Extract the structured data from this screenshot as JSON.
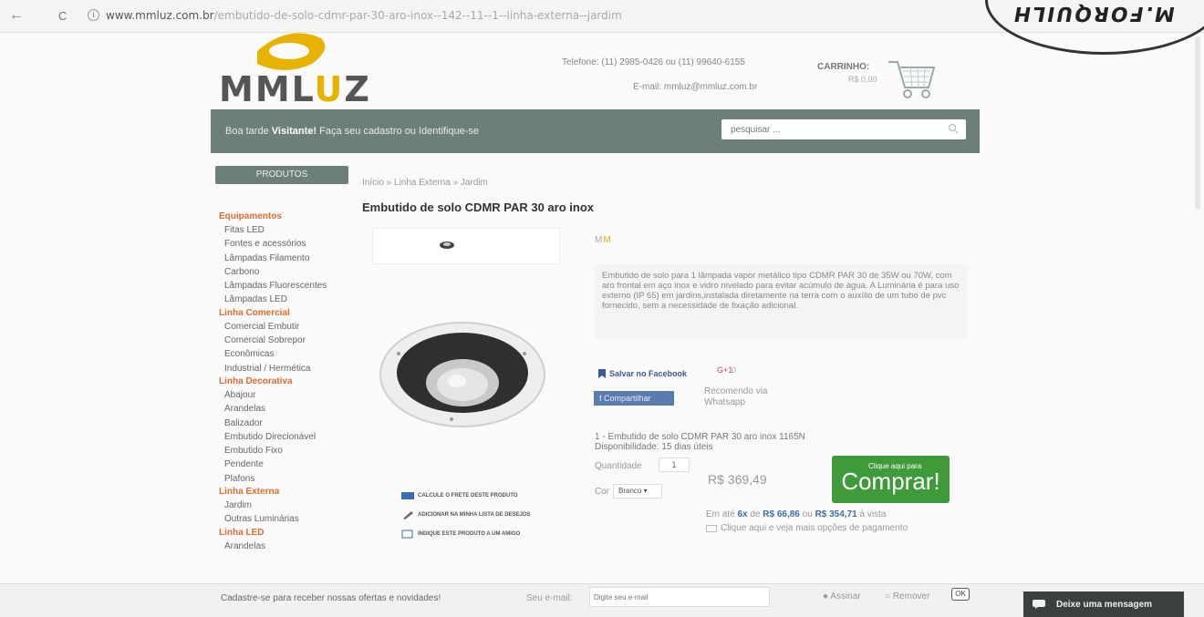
{
  "browser": {
    "back": "←",
    "reload": "C",
    "info": "i",
    "url_domain": "www.mmluz.com.br",
    "url_path": "/embutido-de-solo-cdmr-par-30-aro-inox--142--11--1--linha-externa--jardim"
  },
  "stamp": {
    "text": "M.FORQUILH"
  },
  "header": {
    "logo_text_a": "MML",
    "logo_text_b": "U",
    "logo_text_c": "Z",
    "phone": "Telefone: (11) 2985-0426 ou (11) 99640-6155",
    "email": "E-mail: mmluz@mmluz.com.br",
    "cart_label": "CARRINHO:",
    "cart_value": "R$ 0,00",
    "colors": {
      "logo_accent": "#e7b200",
      "bar": "#6c7f79"
    }
  },
  "greeting": {
    "prefix": "Boa tarde",
    "visitor": "Visitante!",
    "suffix": "Faça seu cadastro ou Identifique-se"
  },
  "search": {
    "placeholder": "pesquisar ..."
  },
  "sidebar": {
    "header": "PRODUTOS",
    "groups": [
      {
        "title": "Equipamentos",
        "items": [
          "Fitas LED",
          "Fontes e acessórios",
          "Lâmpadas Filamento",
          "Carbono",
          "Lâmpadas Fluorescentes",
          "Lâmpadas LED"
        ]
      },
      {
        "title": "Linha Comercial",
        "items": [
          "Comercial Embutir",
          "Comercial Sobrepor",
          "Econômicas",
          "Industrial / Hermética"
        ]
      },
      {
        "title": "Linha Decorativa",
        "items": [
          "Abajour",
          "Arandelas",
          "Balizador",
          "Embutido Direcionável",
          "Embutido Fixo",
          "Pendente",
          "Plafons"
        ]
      },
      {
        "title": "Linha Externa",
        "items": [
          "Jardim",
          "Outras Luminárias"
        ]
      },
      {
        "title": "Linha LED",
        "items": [
          "Arandelas"
        ]
      }
    ]
  },
  "product": {
    "breadcrumb": "Início » Linha Externa » Jardim",
    "title": "Embutido de solo CDMR PAR 30 aro inox",
    "brand_a": "M",
    "brand_b": "M",
    "description": "Embutido de solo para 1 lâmpada vapor metálico tipo CDMR PAR 30 de 35W ou 70W, com aro frontal em aço inox e vidro nivelado para evitar acúmulo de água. A Luminária é para uso externo (IP 65) em jardins,instalada diretamente na terra com o auxílio de um tubo de pvc fornecido, sem a necessidade de fixação adicional.",
    "image_links": [
      "Calcule o frete deste produto",
      "Adicionar na minha lista de desejos",
      "Indique este produto a um amigo"
    ],
    "fb_save": "Salvar no Facebook",
    "gplus": "G+1",
    "gplus_count": "0",
    "fb_share": "Compartilhar",
    "whatsapp_line1": "Recomendo via",
    "whatsapp_line2": "Whatsapp",
    "variant_line1": "1 - Embutido de solo CDMR PAR 30 aro inox 1165N",
    "variant_line2": "Disponibilidade: 15 dias úteis",
    "qty_label": "Quantidade",
    "qty_value": "1",
    "price": "R$ 369,49",
    "color_label": "Cor",
    "color_value": "Branco",
    "buy_small": "Clique aqui para",
    "buy_big": "Comprar!",
    "installments_prefix": "Em até",
    "installments_count": "6x",
    "installments_de": "de",
    "installments_value": "R$ 66,86",
    "installments_ou": "ou",
    "cash_value": "R$ 354,71",
    "cash_suffix": "à vista",
    "more_payment": "Clique aqui e veja mais opções de pagamento",
    "colors": {
      "buy": "#3f9b3a",
      "category": "#e46a2e",
      "fb": "#3b5998"
    }
  },
  "footer": {
    "newsletter": "Cadastre-se para receber nossas ofertas e novidades!",
    "email_label": "Seu e-mail:",
    "email_placeholder": "Digite seu e-mail",
    "subscribe": "Assinar",
    "remove": "Remover",
    "ok": "OK",
    "message": "Deixe uma mensagem"
  }
}
